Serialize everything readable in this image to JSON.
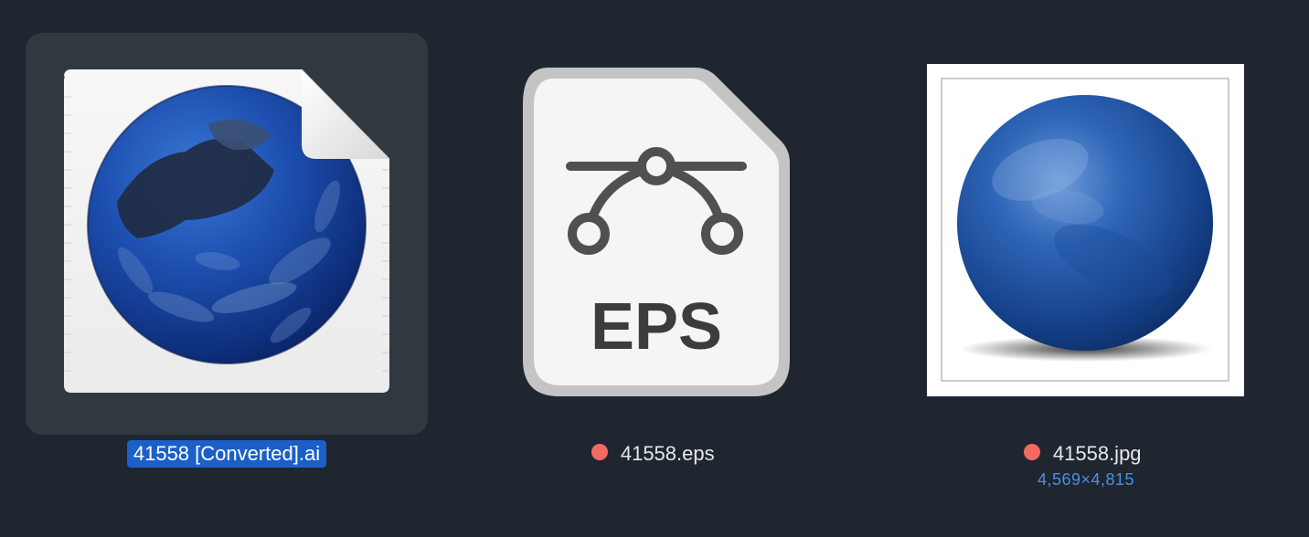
{
  "colors": {
    "background": "#1f2630",
    "selection_tile": "#323840",
    "selection_label": "#1c5fc8",
    "tag_red": "#f46a62",
    "dimensions_text": "#4a90e2"
  },
  "files": [
    {
      "name": "41558 [Converted].ai",
      "selected": true,
      "icon": "illustrator-document-blue-orb-icon"
    },
    {
      "name": "41558.eps",
      "selected": false,
      "tag": "red",
      "icon": "eps-vector-document-icon",
      "icon_text": "EPS"
    },
    {
      "name": "41558.jpg",
      "selected": false,
      "tag": "red",
      "icon": "jpg-thumbnail-blue-sphere-icon",
      "dimensions": "4,569×4,815"
    }
  ]
}
